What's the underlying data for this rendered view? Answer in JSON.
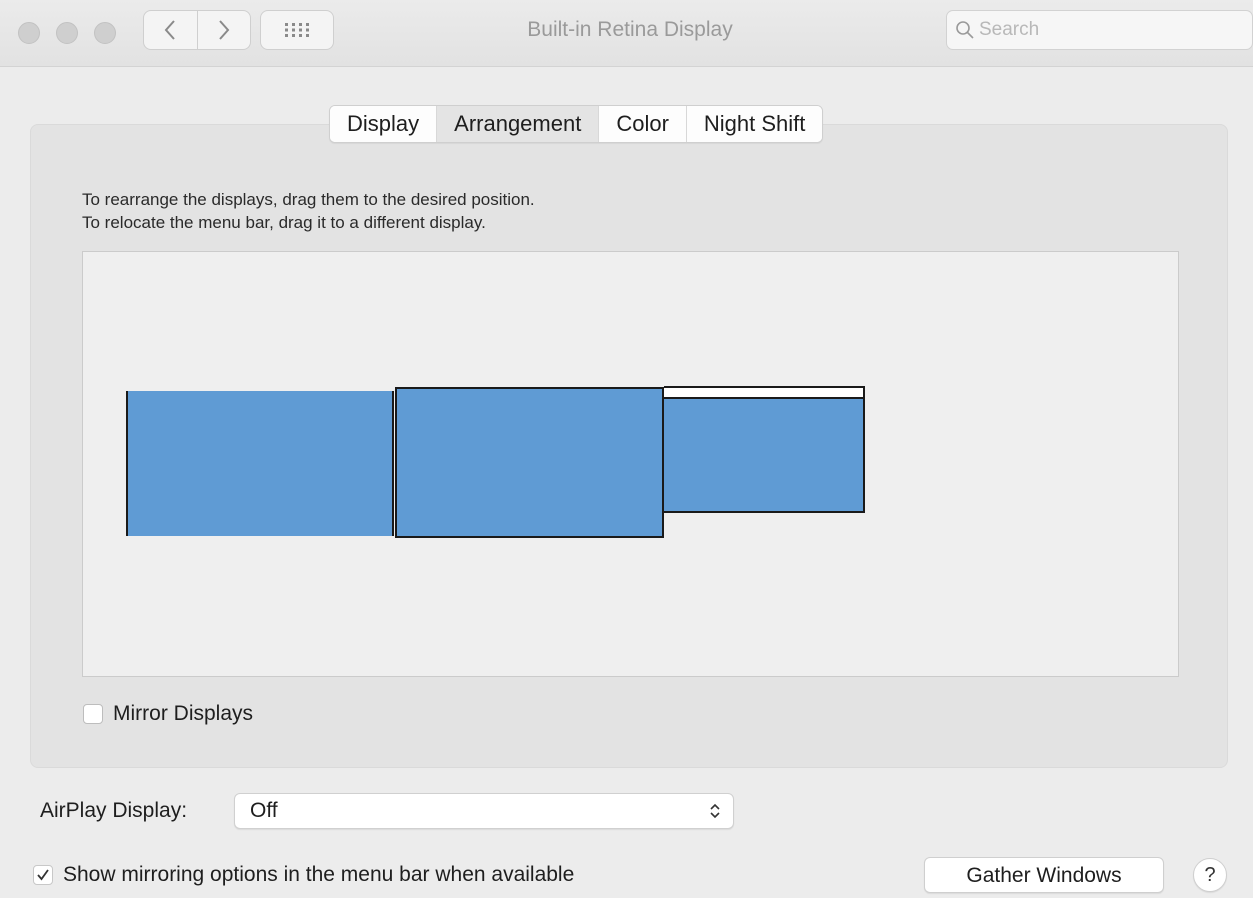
{
  "window": {
    "title": "Built-in Retina Display"
  },
  "search": {
    "placeholder": "Search"
  },
  "tabs": [
    {
      "label": "Display",
      "active": false
    },
    {
      "label": "Arrangement",
      "active": true
    },
    {
      "label": "Color",
      "active": false
    },
    {
      "label": "Night Shift",
      "active": false
    }
  ],
  "arrangement": {
    "instruction_line1": "To rearrange the displays, drag them to the desired position.",
    "instruction_line2": "To relocate the menu bar, drag it to a different display.",
    "display_color": "#5f9bd4",
    "displays": [
      {
        "id": "display-1",
        "has_menu_bar": false
      },
      {
        "id": "display-2",
        "has_menu_bar": false
      },
      {
        "id": "display-3",
        "has_menu_bar": true
      }
    ]
  },
  "mirror_displays": {
    "label": "Mirror Displays",
    "checked": false
  },
  "airplay": {
    "label": "AirPlay Display:",
    "value": "Off"
  },
  "show_mirroring": {
    "label": "Show mirroring options in the menu bar when available",
    "checked": true
  },
  "buttons": {
    "gather_windows": "Gather Windows",
    "help": "?"
  },
  "icons": {
    "close": "traffic-light-close-icon",
    "minimize": "traffic-light-minimize-icon",
    "zoom": "traffic-light-zoom-icon",
    "back": "chevron-left-icon",
    "forward": "chevron-right-icon",
    "show_all": "grid-icon",
    "search": "magnifier-icon",
    "popup": "updown-chevron-icon",
    "checkmark": "checkmark-icon"
  }
}
